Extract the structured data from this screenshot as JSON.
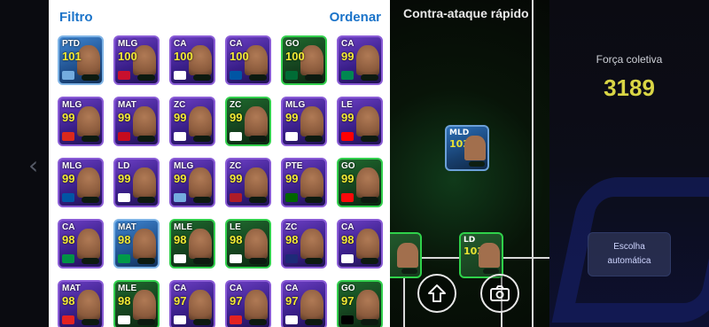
{
  "panel": {
    "filter_label": "Filtro",
    "sort_label": "Ordenar"
  },
  "tactic": {
    "title": "Contra-ataque rápido"
  },
  "team": {
    "strength_label": "Força coletiva",
    "strength_value": "3189"
  },
  "auto_button": {
    "label_line1": "Escolha",
    "label_line2": "automática"
  },
  "icons": {
    "chevron_left": "chevron-left-icon",
    "arrow_up": "arrow-up-icon",
    "camera": "camera-icon"
  },
  "colors": {
    "accent": "#1a73c9",
    "rating": "#f3ea35",
    "strength": "#d9d545"
  },
  "rows": [
    [
      {
        "pos": "PTD",
        "rating": "101",
        "style": "blue",
        "flag": "#74acdf"
      },
      {
        "pos": "MLG",
        "rating": "100",
        "style": "purple",
        "flag": "#c8102e"
      },
      {
        "pos": "CA",
        "rating": "100",
        "style": "purple",
        "flag": "#ffffff"
      },
      {
        "pos": "CA",
        "rating": "100",
        "style": "purple",
        "flag": "#0055a4"
      },
      {
        "pos": "GO",
        "rating": "100",
        "style": "green",
        "flag": "#006c35"
      },
      {
        "pos": "CA",
        "rating": "99",
        "style": "purple",
        "flag": "#008751"
      }
    ],
    [
      {
        "pos": "MLG",
        "rating": "99",
        "style": "purple",
        "flag": "#da291c"
      },
      {
        "pos": "MAT",
        "rating": "99",
        "style": "purple",
        "flag": "#c60b1e"
      },
      {
        "pos": "ZC",
        "rating": "99",
        "style": "purple",
        "flag": "#ffffff"
      },
      {
        "pos": "ZC",
        "rating": "99",
        "style": "green",
        "flag": "#ffffff"
      },
      {
        "pos": "MLG",
        "rating": "99",
        "style": "purple",
        "flag": "#ffffff"
      },
      {
        "pos": "LE",
        "rating": "99",
        "style": "purple",
        "flag": "#ff0000"
      }
    ],
    [
      {
        "pos": "MLG",
        "rating": "99",
        "style": "purple",
        "flag": "#0055a4"
      },
      {
        "pos": "LD",
        "rating": "99",
        "style": "purple",
        "flag": "#ffffff"
      },
      {
        "pos": "MLG",
        "rating": "99",
        "style": "purple",
        "flag": "#74acdf"
      },
      {
        "pos": "ZC",
        "rating": "99",
        "style": "purple",
        "flag": "#ae1c28"
      },
      {
        "pos": "PTE",
        "rating": "99",
        "style": "purple",
        "flag": "#006600"
      },
      {
        "pos": "GO",
        "rating": "99",
        "style": "green",
        "flag": "#fb090b"
      }
    ],
    [
      {
        "pos": "CA",
        "rating": "98",
        "style": "purple",
        "flag": "#009246"
      },
      {
        "pos": "MAT",
        "rating": "98",
        "style": "blue",
        "flag": "#009a49"
      },
      {
        "pos": "MLE",
        "rating": "98",
        "style": "green",
        "flag": "#ffffff"
      },
      {
        "pos": "LE",
        "rating": "98",
        "style": "green",
        "flag": "#ffffff"
      },
      {
        "pos": "ZC",
        "rating": "98",
        "style": "purple",
        "flag": "#1e2a78"
      },
      {
        "pos": "CA",
        "rating": "98",
        "style": "purple",
        "flag": "#ffffff"
      }
    ],
    [
      {
        "pos": "MAT",
        "rating": "98",
        "style": "purple",
        "flag": "#e32221"
      },
      {
        "pos": "MLE",
        "rating": "98",
        "style": "green",
        "flag": "#ffffff"
      },
      {
        "pos": "CA",
        "rating": "97",
        "style": "purple",
        "flag": "#ffffff"
      },
      {
        "pos": "CA",
        "rating": "97",
        "style": "purple",
        "flag": "#e32221"
      },
      {
        "pos": "CA",
        "rating": "97",
        "style": "purple",
        "flag": "#ffffff"
      },
      {
        "pos": "GO",
        "rating": "97",
        "style": "green",
        "flag": "#000000"
      }
    ]
  ],
  "pitch_cards": [
    {
      "pos": "MLD",
      "rating": "103",
      "style": "blue"
    },
    {
      "pos": "LD",
      "rating": "103",
      "style": "green"
    }
  ]
}
